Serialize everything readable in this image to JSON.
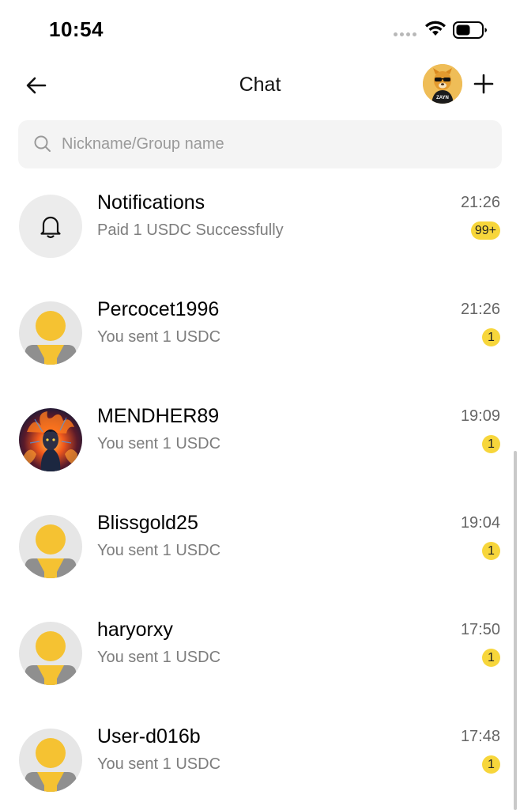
{
  "status_bar": {
    "time": "10:54"
  },
  "header": {
    "title": "Chat",
    "avatar_text": "ZAYN"
  },
  "search": {
    "placeholder": "Nickname/Group name"
  },
  "chats": [
    {
      "name": "Notifications",
      "preview": "Paid 1 USDC Successfully",
      "time": "21:26",
      "badge": "99+",
      "avatar": "bell-icon"
    },
    {
      "name": "Percocet1996",
      "preview": "You sent 1 USDC",
      "time": "21:26",
      "badge": "1",
      "avatar": "default-avatar"
    },
    {
      "name": "MENDHER89",
      "preview": "You sent 1 USDC",
      "time": "19:09",
      "badge": "1",
      "avatar": "fire-portrait"
    },
    {
      "name": "Blissgold25",
      "preview": "You sent 1 USDC",
      "time": "19:04",
      "badge": "1",
      "avatar": "default-avatar"
    },
    {
      "name": "haryorxy",
      "preview": "You sent 1 USDC",
      "time": "17:50",
      "badge": "1",
      "avatar": "default-avatar"
    },
    {
      "name": "User-d016b",
      "preview": "You sent 1 USDC",
      "time": "17:48",
      "badge": "1",
      "avatar": "default-avatar"
    }
  ],
  "colors": {
    "badge": "#f7d63b",
    "search_bg": "#f4f4f4",
    "avatar_bg": "#e6e6e6",
    "avatar_yellow": "#f5c232"
  }
}
